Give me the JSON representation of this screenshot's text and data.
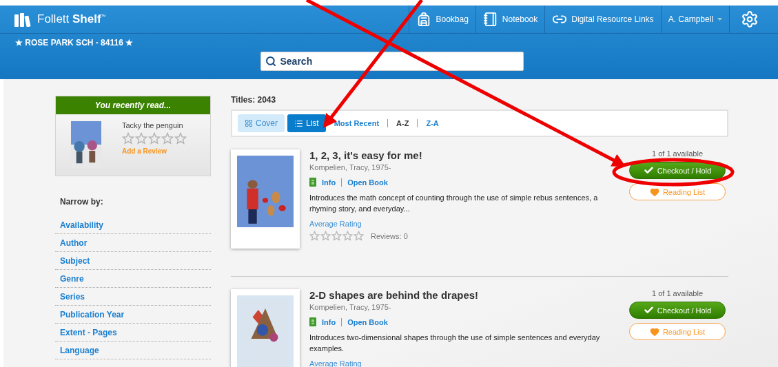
{
  "header": {
    "brand_light": "Follett",
    "brand_bold": "Shelf",
    "brand_mark": "™",
    "school": "★ ROSE PARK SCH - 84116 ★",
    "nav": [
      {
        "label": "Bookbag",
        "kind": "bookbag"
      },
      {
        "label": "Notebook",
        "kind": "notebook"
      },
      {
        "label": "Digital Resource Links",
        "kind": "link"
      },
      {
        "label": "A. Campbell",
        "kind": "user"
      },
      {
        "kind": "settings"
      }
    ],
    "search": {
      "placeholder": "Search"
    }
  },
  "recent": {
    "heading": "You recently read...",
    "title": "Tacky the penguin",
    "stars": 0,
    "review_link": "Add a Review"
  },
  "narrow": {
    "heading": "Narrow by:",
    "items": [
      "Availability",
      "Author",
      "Subject",
      "Genre",
      "Series",
      "Publication Year",
      "Extent - Pages",
      "Language"
    ]
  },
  "results": {
    "count": "Titles: 2043",
    "views": [
      {
        "label": "Cover",
        "kind": "grid",
        "selected": false
      },
      {
        "label": "List",
        "kind": "list",
        "selected": true
      }
    ],
    "sorts": [
      {
        "label": "Most Recent",
        "selected": false
      },
      {
        "label": "A-Z",
        "selected": true
      },
      {
        "label": "Z-A",
        "selected": false
      }
    ],
    "books": [
      {
        "title": "1, 2, 3, it's easy for me!",
        "author": "Kompelien, Tracy, 1975-",
        "info": "Info",
        "open": "Open Book",
        "summary": "Introduces the math concept of counting through the use of simple rebus sentences, a rhyming story, and everyday...",
        "rating_label": "Average Rating",
        "stars": 0,
        "reviews": "Reviews: 0",
        "availability": "1 of 1 available",
        "checkout": "Checkout / Hold",
        "reading_list": "Reading List"
      },
      {
        "title": "2-D shapes are behind the drapes!",
        "author": "Kompelien, Tracy, 1975-",
        "info": "Info",
        "open": "Open Book",
        "summary": "Introduces two-dimensional shapes through the use of simple sentences and everyday examples.",
        "rating_label": "Average Rating",
        "availability": "1 of 1 available",
        "checkout": "Checkout / Hold",
        "reading_list": "Reading List"
      }
    ]
  }
}
